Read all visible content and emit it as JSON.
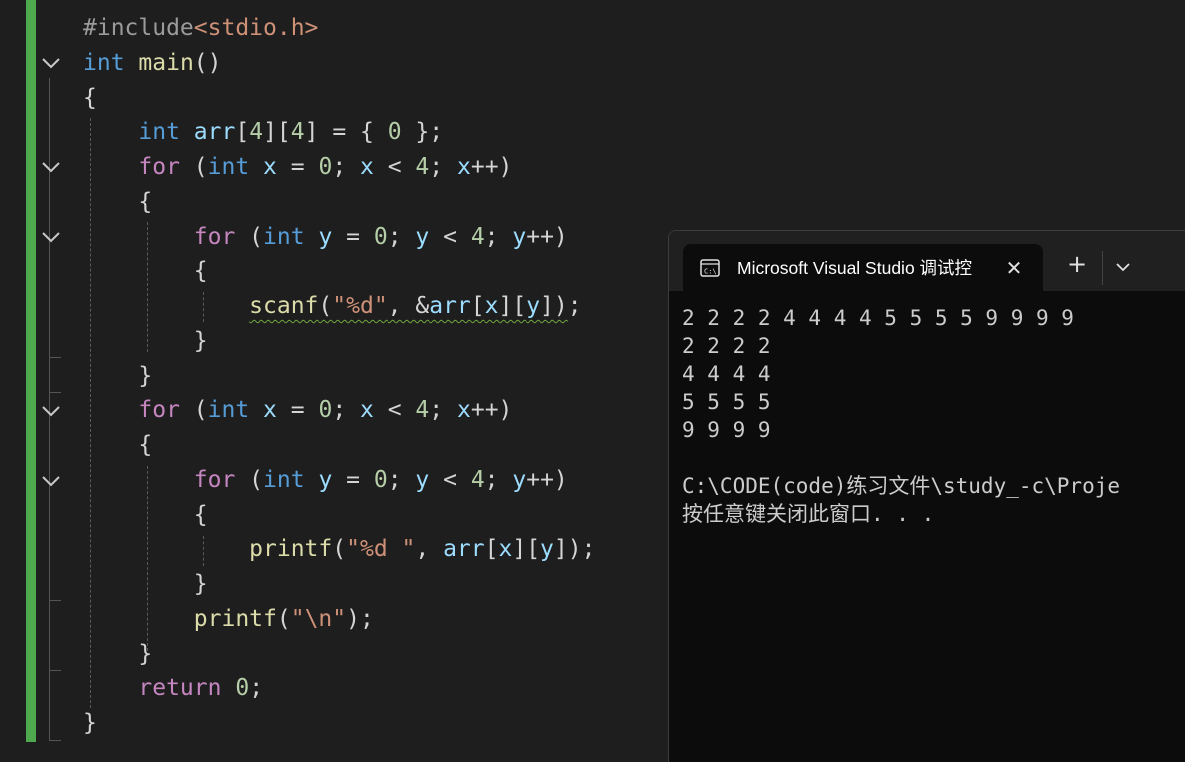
{
  "editor": {
    "lines": [
      [
        {
          "t": "#include",
          "c": "pp"
        },
        {
          "t": "<stdio.h>",
          "c": "str"
        }
      ],
      [
        {
          "t": "int",
          "c": "kw"
        },
        {
          "t": " ",
          "c": "op"
        },
        {
          "t": "main",
          "c": "fn"
        },
        {
          "t": "()",
          "c": "op"
        }
      ],
      [
        {
          "t": "{",
          "c": "op"
        }
      ],
      [
        {
          "t": "    ",
          "c": "op"
        },
        {
          "t": "int",
          "c": "kw"
        },
        {
          "t": " ",
          "c": "op"
        },
        {
          "t": "arr",
          "c": "var"
        },
        {
          "t": "[",
          "c": "op"
        },
        {
          "t": "4",
          "c": "num"
        },
        {
          "t": "][",
          "c": "op"
        },
        {
          "t": "4",
          "c": "num"
        },
        {
          "t": "] = { ",
          "c": "op"
        },
        {
          "t": "0",
          "c": "num"
        },
        {
          "t": " };",
          "c": "op"
        }
      ],
      [
        {
          "t": "    ",
          "c": "op"
        },
        {
          "t": "for",
          "c": "ctl"
        },
        {
          "t": " (",
          "c": "op"
        },
        {
          "t": "int",
          "c": "kw"
        },
        {
          "t": " ",
          "c": "op"
        },
        {
          "t": "x",
          "c": "var"
        },
        {
          "t": " = ",
          "c": "op"
        },
        {
          "t": "0",
          "c": "num"
        },
        {
          "t": "; ",
          "c": "op"
        },
        {
          "t": "x",
          "c": "var"
        },
        {
          "t": " < ",
          "c": "op"
        },
        {
          "t": "4",
          "c": "num"
        },
        {
          "t": "; ",
          "c": "op"
        },
        {
          "t": "x",
          "c": "var"
        },
        {
          "t": "++)",
          "c": "op"
        }
      ],
      [
        {
          "t": "    {",
          "c": "op"
        }
      ],
      [
        {
          "t": "        ",
          "c": "op"
        },
        {
          "t": "for",
          "c": "ctl"
        },
        {
          "t": " (",
          "c": "op"
        },
        {
          "t": "int",
          "c": "kw"
        },
        {
          "t": " ",
          "c": "op"
        },
        {
          "t": "y",
          "c": "var"
        },
        {
          "t": " = ",
          "c": "op"
        },
        {
          "t": "0",
          "c": "num"
        },
        {
          "t": "; ",
          "c": "op"
        },
        {
          "t": "y",
          "c": "var"
        },
        {
          "t": " < ",
          "c": "op"
        },
        {
          "t": "4",
          "c": "num"
        },
        {
          "t": "; ",
          "c": "op"
        },
        {
          "t": "y",
          "c": "var"
        },
        {
          "t": "++)",
          "c": "op"
        }
      ],
      [
        {
          "t": "        {",
          "c": "op"
        }
      ],
      [
        {
          "t": "            ",
          "c": "op"
        },
        {
          "t": "scanf",
          "c": "fn squig"
        },
        {
          "t": "(",
          "c": "op squig"
        },
        {
          "t": "\"%d\"",
          "c": "str squig"
        },
        {
          "t": ", &",
          "c": "op squig"
        },
        {
          "t": "arr",
          "c": "var squig"
        },
        {
          "t": "[",
          "c": "op squig"
        },
        {
          "t": "x",
          "c": "var squig"
        },
        {
          "t": "][",
          "c": "op squig"
        },
        {
          "t": "y",
          "c": "var squig"
        },
        {
          "t": "])",
          "c": "op squig"
        },
        {
          "t": ";",
          "c": "op"
        }
      ],
      [
        {
          "t": "        }",
          "c": "op"
        }
      ],
      [
        {
          "t": "    }",
          "c": "op"
        }
      ],
      [
        {
          "t": "    ",
          "c": "op"
        },
        {
          "t": "for",
          "c": "ctl"
        },
        {
          "t": " (",
          "c": "op"
        },
        {
          "t": "int",
          "c": "kw"
        },
        {
          "t": " ",
          "c": "op"
        },
        {
          "t": "x",
          "c": "var"
        },
        {
          "t": " = ",
          "c": "op"
        },
        {
          "t": "0",
          "c": "num"
        },
        {
          "t": "; ",
          "c": "op"
        },
        {
          "t": "x",
          "c": "var"
        },
        {
          "t": " < ",
          "c": "op"
        },
        {
          "t": "4",
          "c": "num"
        },
        {
          "t": "; ",
          "c": "op"
        },
        {
          "t": "x",
          "c": "var"
        },
        {
          "t": "++)",
          "c": "op"
        }
      ],
      [
        {
          "t": "    {",
          "c": "op"
        }
      ],
      [
        {
          "t": "        ",
          "c": "op"
        },
        {
          "t": "for",
          "c": "ctl"
        },
        {
          "t": " (",
          "c": "op"
        },
        {
          "t": "int",
          "c": "kw"
        },
        {
          "t": " ",
          "c": "op"
        },
        {
          "t": "y",
          "c": "var"
        },
        {
          "t": " = ",
          "c": "op"
        },
        {
          "t": "0",
          "c": "num"
        },
        {
          "t": "; ",
          "c": "op"
        },
        {
          "t": "y",
          "c": "var"
        },
        {
          "t": " < ",
          "c": "op"
        },
        {
          "t": "4",
          "c": "num"
        },
        {
          "t": "; ",
          "c": "op"
        },
        {
          "t": "y",
          "c": "var"
        },
        {
          "t": "++)",
          "c": "op"
        }
      ],
      [
        {
          "t": "        {",
          "c": "op"
        }
      ],
      [
        {
          "t": "            ",
          "c": "op"
        },
        {
          "t": "printf",
          "c": "fn"
        },
        {
          "t": "(",
          "c": "op"
        },
        {
          "t": "\"%d \"",
          "c": "str"
        },
        {
          "t": ", ",
          "c": "op"
        },
        {
          "t": "arr",
          "c": "var"
        },
        {
          "t": "[",
          "c": "op"
        },
        {
          "t": "x",
          "c": "var"
        },
        {
          "t": "][",
          "c": "op"
        },
        {
          "t": "y",
          "c": "var"
        },
        {
          "t": "]);",
          "c": "op"
        }
      ],
      [
        {
          "t": "        }",
          "c": "op"
        }
      ],
      [
        {
          "t": "        ",
          "c": "op"
        },
        {
          "t": "printf",
          "c": "fn"
        },
        {
          "t": "(",
          "c": "op"
        },
        {
          "t": "\"\\n\"",
          "c": "str"
        },
        {
          "t": ");",
          "c": "op"
        }
      ],
      [
        {
          "t": "    }",
          "c": "op"
        }
      ],
      [
        {
          "t": "    ",
          "c": "op"
        },
        {
          "t": "return",
          "c": "ctl"
        },
        {
          "t": " ",
          "c": "op"
        },
        {
          "t": "0",
          "c": "num"
        },
        {
          "t": ";",
          "c": "op"
        }
      ],
      [
        {
          "t": "}",
          "c": "op"
        }
      ]
    ]
  },
  "colors": {
    "editor_bg": "#1e1e1e",
    "change_bar": "#4ea84e",
    "terminal_bg": "#0c0c0c",
    "keyword": "#569cd6",
    "control": "#c586c0",
    "function": "#dcdcaa",
    "variable": "#9cdcfe",
    "number": "#b5cea8",
    "string": "#ce9178"
  },
  "terminal": {
    "tab_title": "Microsoft Visual Studio 调试控",
    "tab_icon": "console-icon",
    "close_glyph": "✕",
    "new_tab_glyph": "+",
    "output": [
      "2 2 2 2 4 4 4 4 5 5 5 5 9 9 9 9",
      "2 2 2 2",
      "4 4 4 4",
      "5 5 5 5",
      "9 9 9 9",
      "",
      "C:\\CODE(code)练习文件\\study_-c\\Proje",
      "按任意键关闭此窗口. . ."
    ]
  }
}
